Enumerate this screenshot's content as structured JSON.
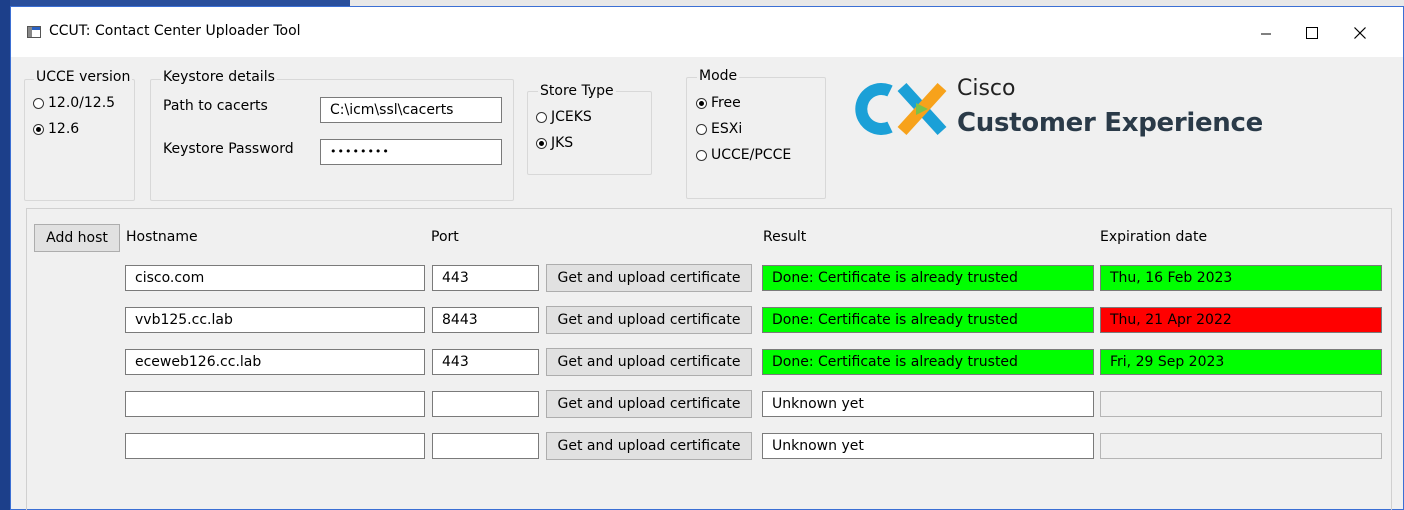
{
  "window": {
    "title": "CCUT: Contact Center Uploader Tool"
  },
  "ucce_version": {
    "label": "UCCE version",
    "options": [
      {
        "label": "12.0/12.5",
        "selected": false
      },
      {
        "label": "12.6",
        "selected": true
      }
    ]
  },
  "keystore": {
    "label": "Keystore details",
    "path_label": "Path to cacerts",
    "path_value": "C:\\icm\\ssl\\cacerts",
    "password_label": "Keystore Password",
    "password_value": "••••••••"
  },
  "store_type": {
    "label": "Store Type",
    "options": [
      {
        "label": "JCEKS",
        "selected": false
      },
      {
        "label": "JKS",
        "selected": true
      }
    ]
  },
  "mode": {
    "label": "Mode",
    "options": [
      {
        "label": "Free",
        "selected": true
      },
      {
        "label": "ESXi",
        "selected": false
      },
      {
        "label": "UCCE/PCCE",
        "selected": false
      }
    ]
  },
  "logo": {
    "line1": "Cisco",
    "line2": "Customer Experience"
  },
  "table": {
    "add_host_label": "Add host",
    "headers": {
      "hostname": "Hostname",
      "port": "Port",
      "result": "Result",
      "expiration": "Expiration date"
    },
    "action_label": "Get and upload certificate",
    "rows": [
      {
        "hostname": "cisco.com",
        "port": "443",
        "result": "Done: Certificate is already trusted",
        "result_status": "green",
        "expiration": "Thu, 16 Feb 2023",
        "expiration_status": "green"
      },
      {
        "hostname": "vvb125.cc.lab",
        "port": "8443",
        "result": "Done: Certificate is already trusted",
        "result_status": "green",
        "expiration": "Thu, 21 Apr 2022",
        "expiration_status": "red"
      },
      {
        "hostname": "eceweb126.cc.lab",
        "port": "443",
        "result": "Done: Certificate is already trusted",
        "result_status": "green",
        "expiration": "Fri, 29 Sep 2023",
        "expiration_status": "green"
      },
      {
        "hostname": "",
        "port": "",
        "result": "Unknown yet",
        "result_status": "neutral",
        "expiration": "",
        "expiration_status": "empty"
      },
      {
        "hostname": "",
        "port": "",
        "result": "Unknown yet",
        "result_status": "neutral",
        "expiration": "",
        "expiration_status": "empty"
      }
    ]
  },
  "colors": {
    "success": "#00ff00",
    "expired": "#ff0000",
    "logo_blue": "#1ba0d7",
    "logo_orange": "#f7a21b"
  }
}
